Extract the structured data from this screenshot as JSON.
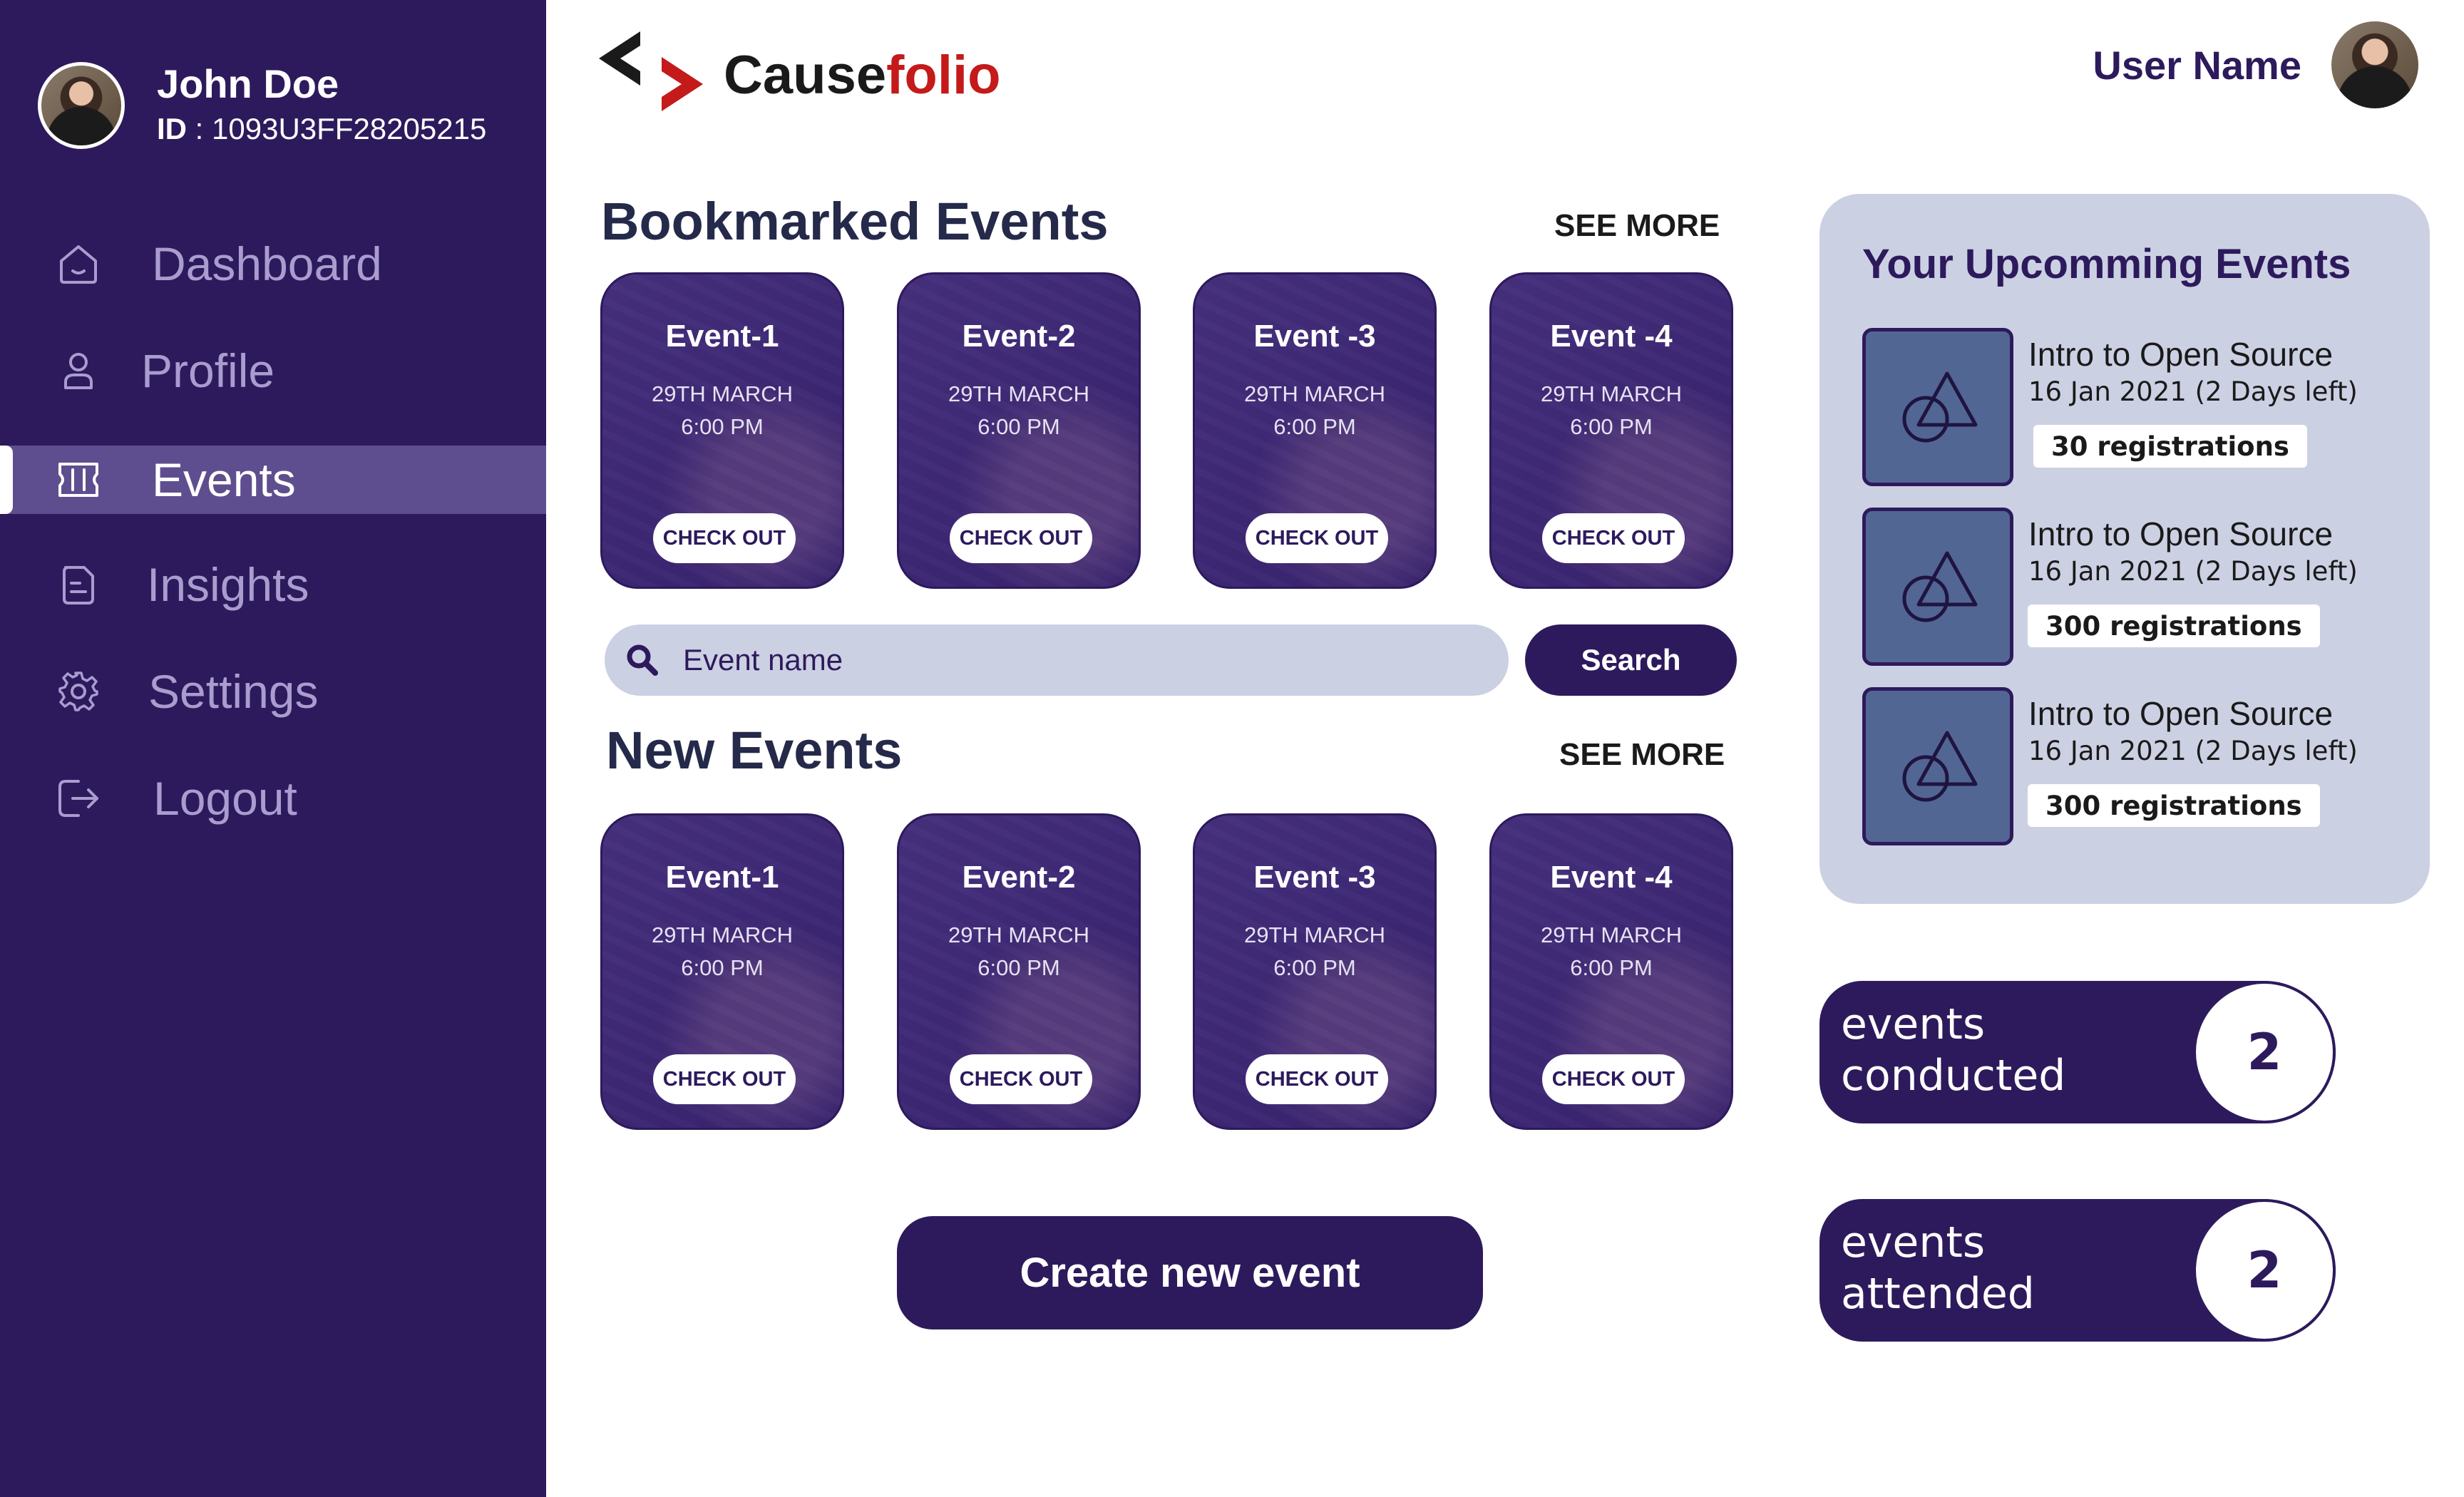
{
  "profile": {
    "name": "John Doe",
    "id_label": "ID",
    "id_value": "1093U3FF28205215"
  },
  "sidebar": {
    "items": [
      {
        "label": "Dashboard",
        "icon": "home-icon"
      },
      {
        "label": "Profile",
        "icon": "user-icon"
      },
      {
        "label": "Events",
        "icon": "ticket-icon",
        "active": true
      },
      {
        "label": "Insights",
        "icon": "document-icon"
      },
      {
        "label": "Settings",
        "icon": "gear-icon"
      },
      {
        "label": "Logout",
        "icon": "logout-icon"
      }
    ]
  },
  "header": {
    "logo_main": "Cause",
    "logo_accent": "folio",
    "user_name": "User Name"
  },
  "bookmarked": {
    "title": "Bookmarked Events",
    "see_more": "SEE MORE",
    "events": [
      {
        "title": "Event-1",
        "date": "29TH MARCH",
        "time": "6:00 PM",
        "action": "CHECK OUT"
      },
      {
        "title": "Event-2",
        "date": "29TH MARCH",
        "time": "6:00 PM",
        "action": "CHECK OUT"
      },
      {
        "title": "Event -3",
        "date": "29TH MARCH",
        "time": "6:00 PM",
        "action": "CHECK OUT"
      },
      {
        "title": "Event -4",
        "date": "29TH MARCH",
        "time": "6:00 PM",
        "action": "CHECK OUT"
      }
    ]
  },
  "search": {
    "placeholder": "Event name",
    "button": "Search"
  },
  "new_events": {
    "title": "New Events",
    "see_more": "SEE MORE",
    "events": [
      {
        "title": "Event-1",
        "date": "29TH MARCH",
        "time": "6:00 PM",
        "action": "CHECK OUT"
      },
      {
        "title": "Event-2",
        "date": "29TH MARCH",
        "time": "6:00 PM",
        "action": "CHECK OUT"
      },
      {
        "title": "Event -3",
        "date": "29TH MARCH",
        "time": "6:00 PM",
        "action": "CHECK OUT"
      },
      {
        "title": "Event -4",
        "date": "29TH MARCH",
        "time": "6:00 PM",
        "action": "CHECK OUT"
      }
    ]
  },
  "create_button": "Create new event",
  "upcoming": {
    "title": "Your Upcomming Events",
    "items": [
      {
        "name": "Intro to Open Source",
        "date": "16 Jan 2021 (2 Days left)",
        "registrations": "30 registrations"
      },
      {
        "name": "Intro to Open Source",
        "date": "16 Jan 2021 (2 Days left)",
        "registrations": "300 registrations"
      },
      {
        "name": "Intro to Open Source",
        "date": "16 Jan 2021 (2 Days left)",
        "registrations": "300 registrations"
      }
    ]
  },
  "stats": {
    "conducted": {
      "label": "events conducted",
      "value": "2"
    },
    "attended": {
      "label": "events attended",
      "value": "2"
    }
  },
  "colors": {
    "primary": "#2d1a5c",
    "active_nav": "#5f4e8f",
    "panel": "#ccd0e3",
    "logo_accent": "#c41a1a",
    "thumb": "#526694"
  }
}
